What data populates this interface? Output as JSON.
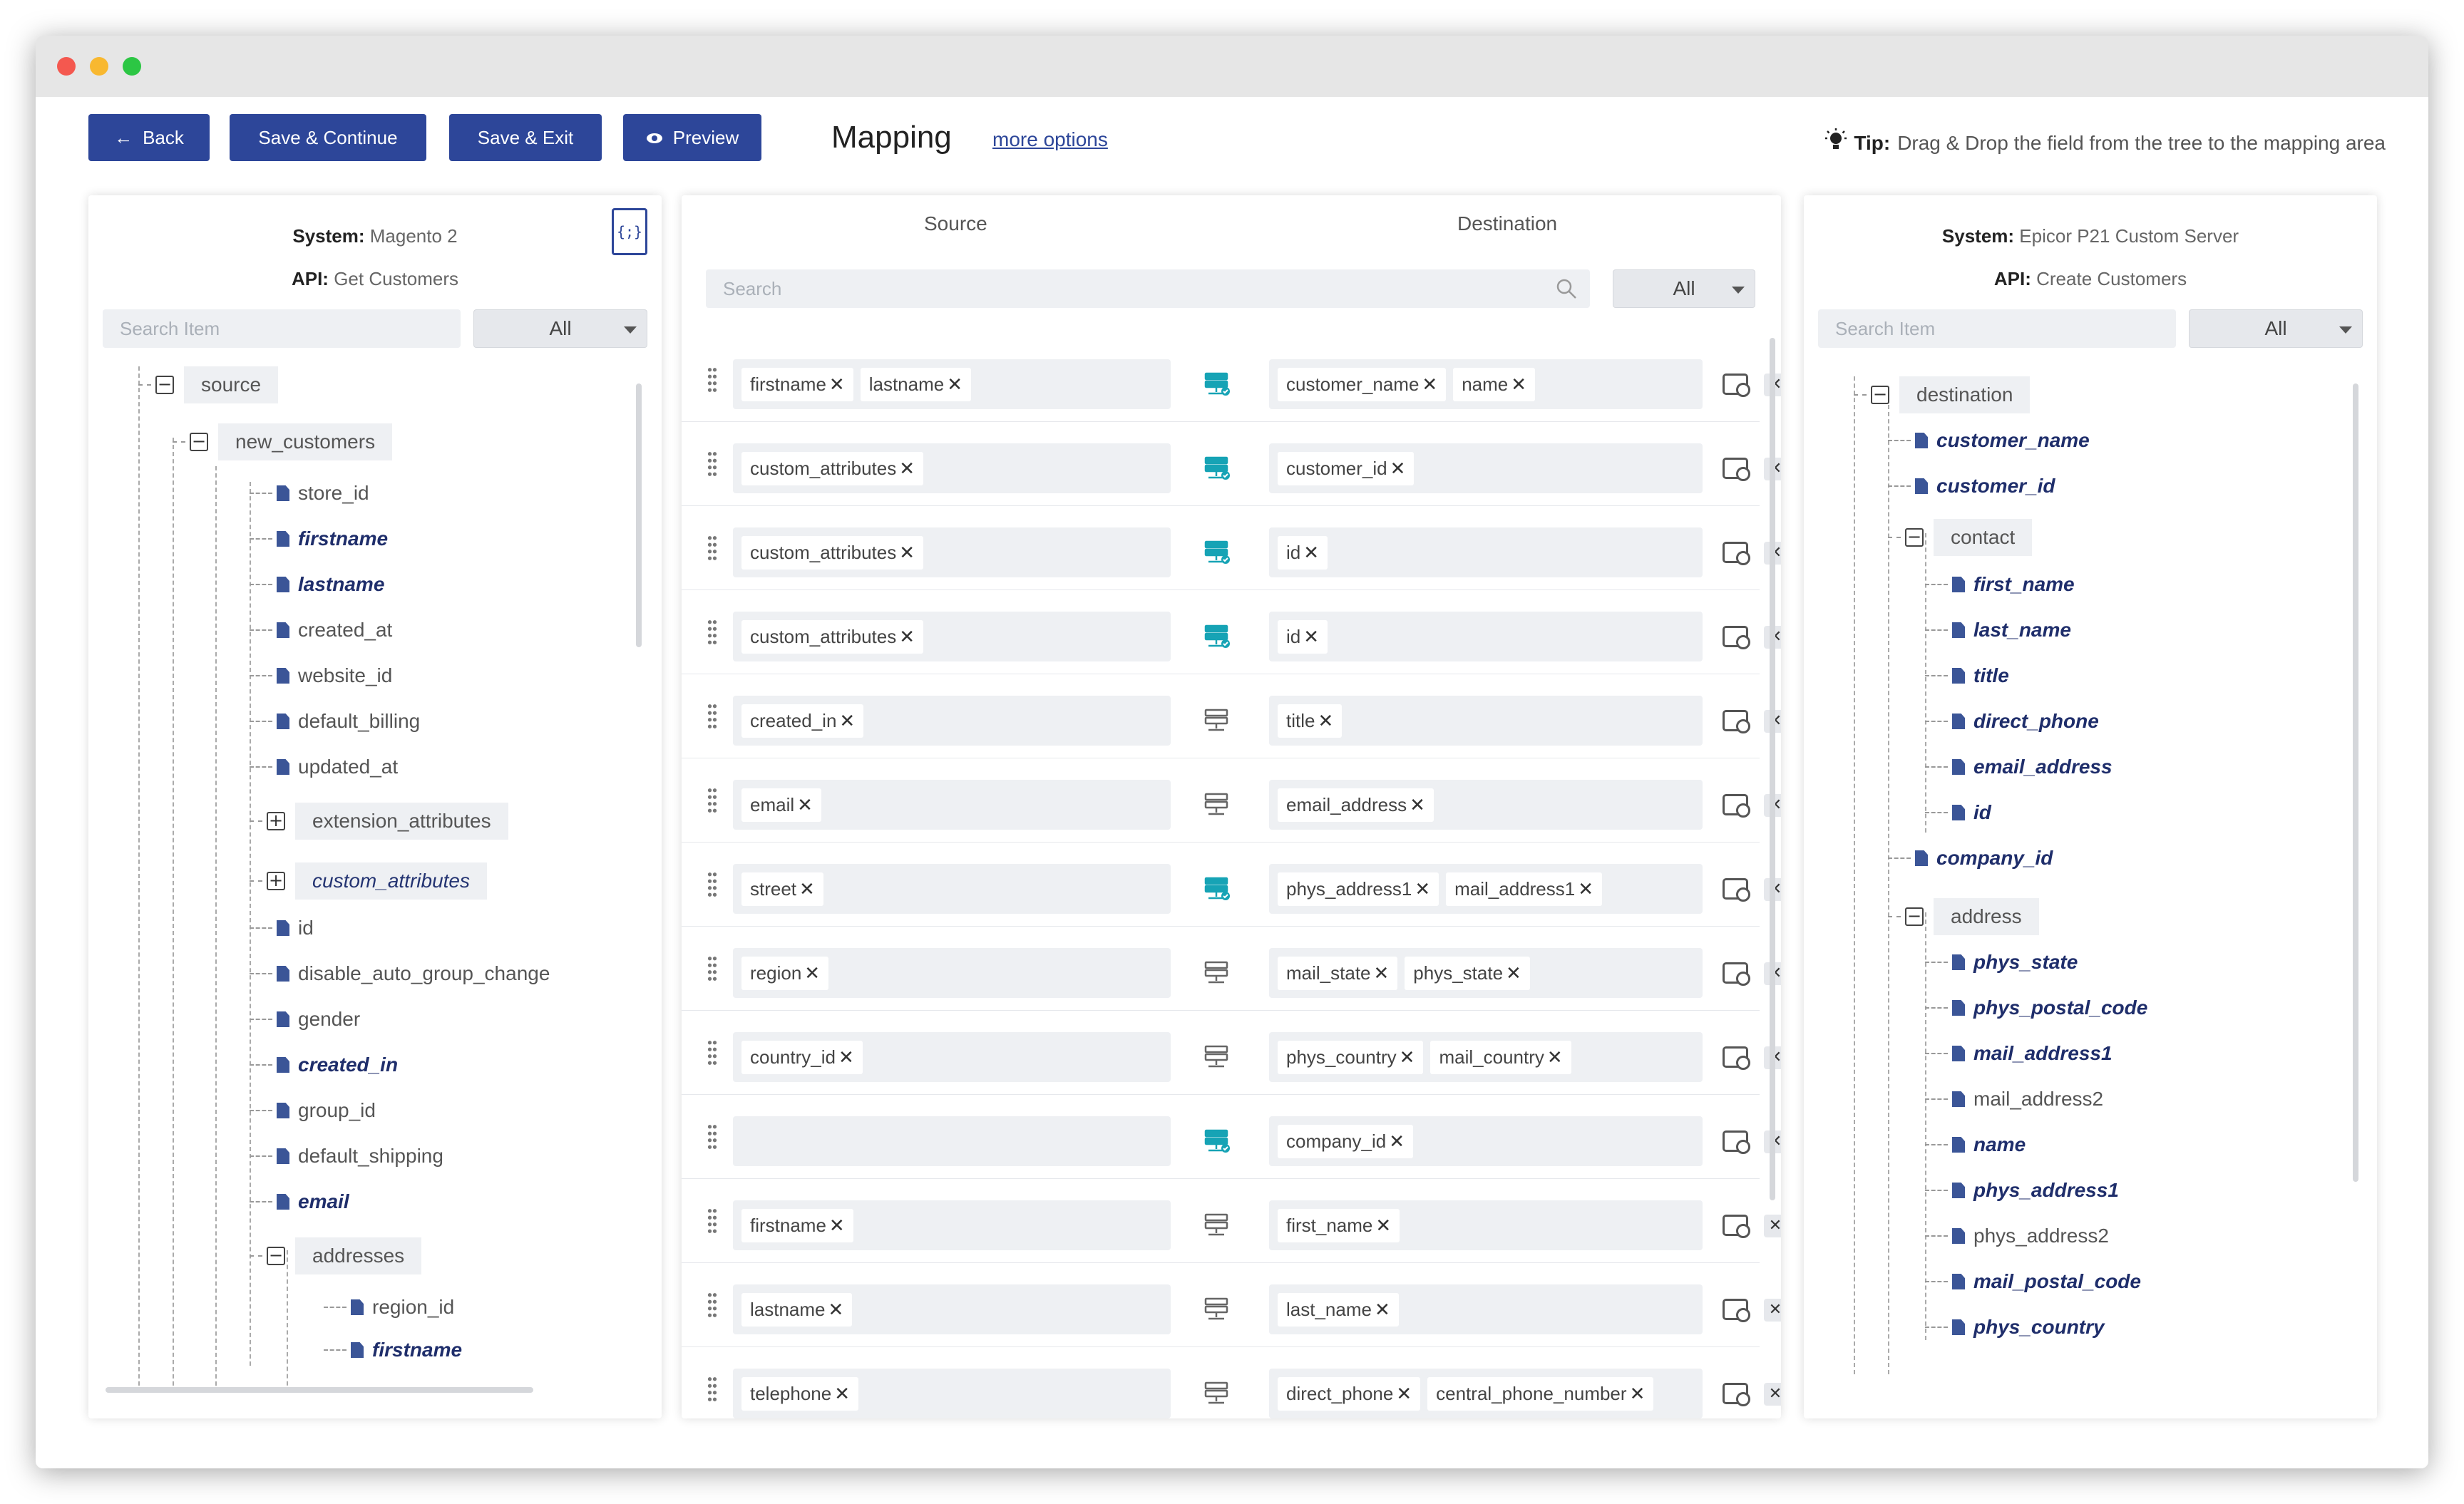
{
  "toolbar": {
    "back": "Back",
    "save_continue": "Save & Continue",
    "save_exit": "Save & Exit",
    "preview": "Preview",
    "title": "Mapping",
    "more_options": "more options",
    "tip_label": "Tip:",
    "tip_text": "Drag & Drop the field from the tree to the mapping area"
  },
  "left": {
    "system_label": "System:",
    "system_value": "Magento 2",
    "api_label": "API:",
    "api_value": "Get Customers",
    "json_icon_text": "{;}",
    "search_placeholder": "Search Item",
    "filter": "All",
    "tree": [
      {
        "label": "source",
        "kind": "branch",
        "toggle": "−",
        "mapped": false
      },
      {
        "label": "new_customers",
        "kind": "branch",
        "toggle": "−",
        "mapped": false
      },
      {
        "label": "store_id",
        "kind": "leaf",
        "mapped": false
      },
      {
        "label": "firstname",
        "kind": "leaf",
        "mapped": true
      },
      {
        "label": "lastname",
        "kind": "leaf",
        "mapped": true
      },
      {
        "label": "created_at",
        "kind": "leaf",
        "mapped": false
      },
      {
        "label": "website_id",
        "kind": "leaf",
        "mapped": false
      },
      {
        "label": "default_billing",
        "kind": "leaf",
        "mapped": false
      },
      {
        "label": "updated_at",
        "kind": "leaf",
        "mapped": false
      },
      {
        "label": "extension_attributes",
        "kind": "branch",
        "toggle": "+",
        "mapped": false
      },
      {
        "label": "custom_attributes",
        "kind": "branch",
        "toggle": "+",
        "mapped": true
      },
      {
        "label": "id",
        "kind": "leaf",
        "mapped": false
      },
      {
        "label": "disable_auto_group_change",
        "kind": "leaf",
        "mapped": false
      },
      {
        "label": "gender",
        "kind": "leaf",
        "mapped": false
      },
      {
        "label": "created_in",
        "kind": "leaf",
        "mapped": true
      },
      {
        "label": "group_id",
        "kind": "leaf",
        "mapped": false
      },
      {
        "label": "default_shipping",
        "kind": "leaf",
        "mapped": false
      },
      {
        "label": "email",
        "kind": "leaf",
        "mapped": true
      },
      {
        "label": "addresses",
        "kind": "branch",
        "toggle": "−",
        "mapped": false
      },
      {
        "label": "region_id",
        "kind": "leaf",
        "mapped": false
      },
      {
        "label": "firstname",
        "kind": "leaf",
        "mapped": true
      }
    ]
  },
  "middle": {
    "source_header": "Source",
    "destination_header": "Destination",
    "search_placeholder": "Search",
    "filter": "All",
    "rows": [
      {
        "src": [
          "firstname",
          "lastname"
        ],
        "dst": [
          "customer_name",
          "name"
        ],
        "icon": "teal"
      },
      {
        "src": [
          "custom_attributes"
        ],
        "dst": [
          "customer_id"
        ],
        "icon": "teal"
      },
      {
        "src": [
          "custom_attributes"
        ],
        "dst": [
          "id"
        ],
        "icon": "teal"
      },
      {
        "src": [
          "custom_attributes"
        ],
        "dst": [
          "id"
        ],
        "icon": "teal"
      },
      {
        "src": [
          "created_in"
        ],
        "dst": [
          "title"
        ],
        "icon": "gray"
      },
      {
        "src": [
          "email"
        ],
        "dst": [
          "email_address"
        ],
        "icon": "gray"
      },
      {
        "src": [
          "street"
        ],
        "dst": [
          "phys_address1",
          "mail_address1"
        ],
        "icon": "teal"
      },
      {
        "src": [
          "region"
        ],
        "dst": [
          "mail_state",
          "phys_state"
        ],
        "icon": "gray"
      },
      {
        "src": [
          "country_id"
        ],
        "dst": [
          "phys_country",
          "mail_country"
        ],
        "icon": "gray"
      },
      {
        "src": [],
        "dst": [
          "company_id"
        ],
        "icon": "teal"
      },
      {
        "src": [
          "firstname"
        ],
        "dst": [
          "first_name"
        ],
        "icon": "gray"
      },
      {
        "src": [
          "lastname"
        ],
        "dst": [
          "last_name"
        ],
        "icon": "gray"
      },
      {
        "src": [
          "telephone"
        ],
        "dst": [
          "direct_phone",
          "central_phone_number"
        ],
        "icon": "gray"
      }
    ]
  },
  "right": {
    "system_label": "System:",
    "system_value": "Epicor P21 Custom Server",
    "api_label": "API:",
    "api_value": "Create Customers",
    "search_placeholder": "Search Item",
    "filter": "All",
    "tree": [
      {
        "label": "destination",
        "kind": "branch",
        "toggle": "−",
        "mapped": false
      },
      {
        "label": "customer_name",
        "kind": "leaf",
        "mapped": true
      },
      {
        "label": "customer_id",
        "kind": "leaf",
        "mapped": true
      },
      {
        "label": "contact",
        "kind": "branch",
        "toggle": "−",
        "mapped": false
      },
      {
        "label": "first_name",
        "kind": "leaf",
        "mapped": true
      },
      {
        "label": "last_name",
        "kind": "leaf",
        "mapped": true
      },
      {
        "label": "title",
        "kind": "leaf",
        "mapped": true
      },
      {
        "label": "direct_phone",
        "kind": "leaf",
        "mapped": true
      },
      {
        "label": "email_address",
        "kind": "leaf",
        "mapped": true
      },
      {
        "label": "id",
        "kind": "leaf",
        "mapped": true
      },
      {
        "label": "company_id",
        "kind": "leaf",
        "mapped": true
      },
      {
        "label": "address",
        "kind": "branch",
        "toggle": "−",
        "mapped": false
      },
      {
        "label": "phys_state",
        "kind": "leaf",
        "mapped": true
      },
      {
        "label": "phys_postal_code",
        "kind": "leaf",
        "mapped": true
      },
      {
        "label": "mail_address1",
        "kind": "leaf",
        "mapped": true
      },
      {
        "label": "mail_address2",
        "kind": "leaf",
        "mapped": false
      },
      {
        "label": "name",
        "kind": "leaf",
        "mapped": true
      },
      {
        "label": "phys_address1",
        "kind": "leaf",
        "mapped": true
      },
      {
        "label": "phys_address2",
        "kind": "leaf",
        "mapped": false
      },
      {
        "label": "mail_postal_code",
        "kind": "leaf",
        "mapped": true
      },
      {
        "label": "phys_country",
        "kind": "leaf",
        "mapped": true
      }
    ]
  },
  "colors": {
    "primary": "#2d4699",
    "teal": "#16a3b5",
    "mapped_text": "#1f2e6b"
  }
}
